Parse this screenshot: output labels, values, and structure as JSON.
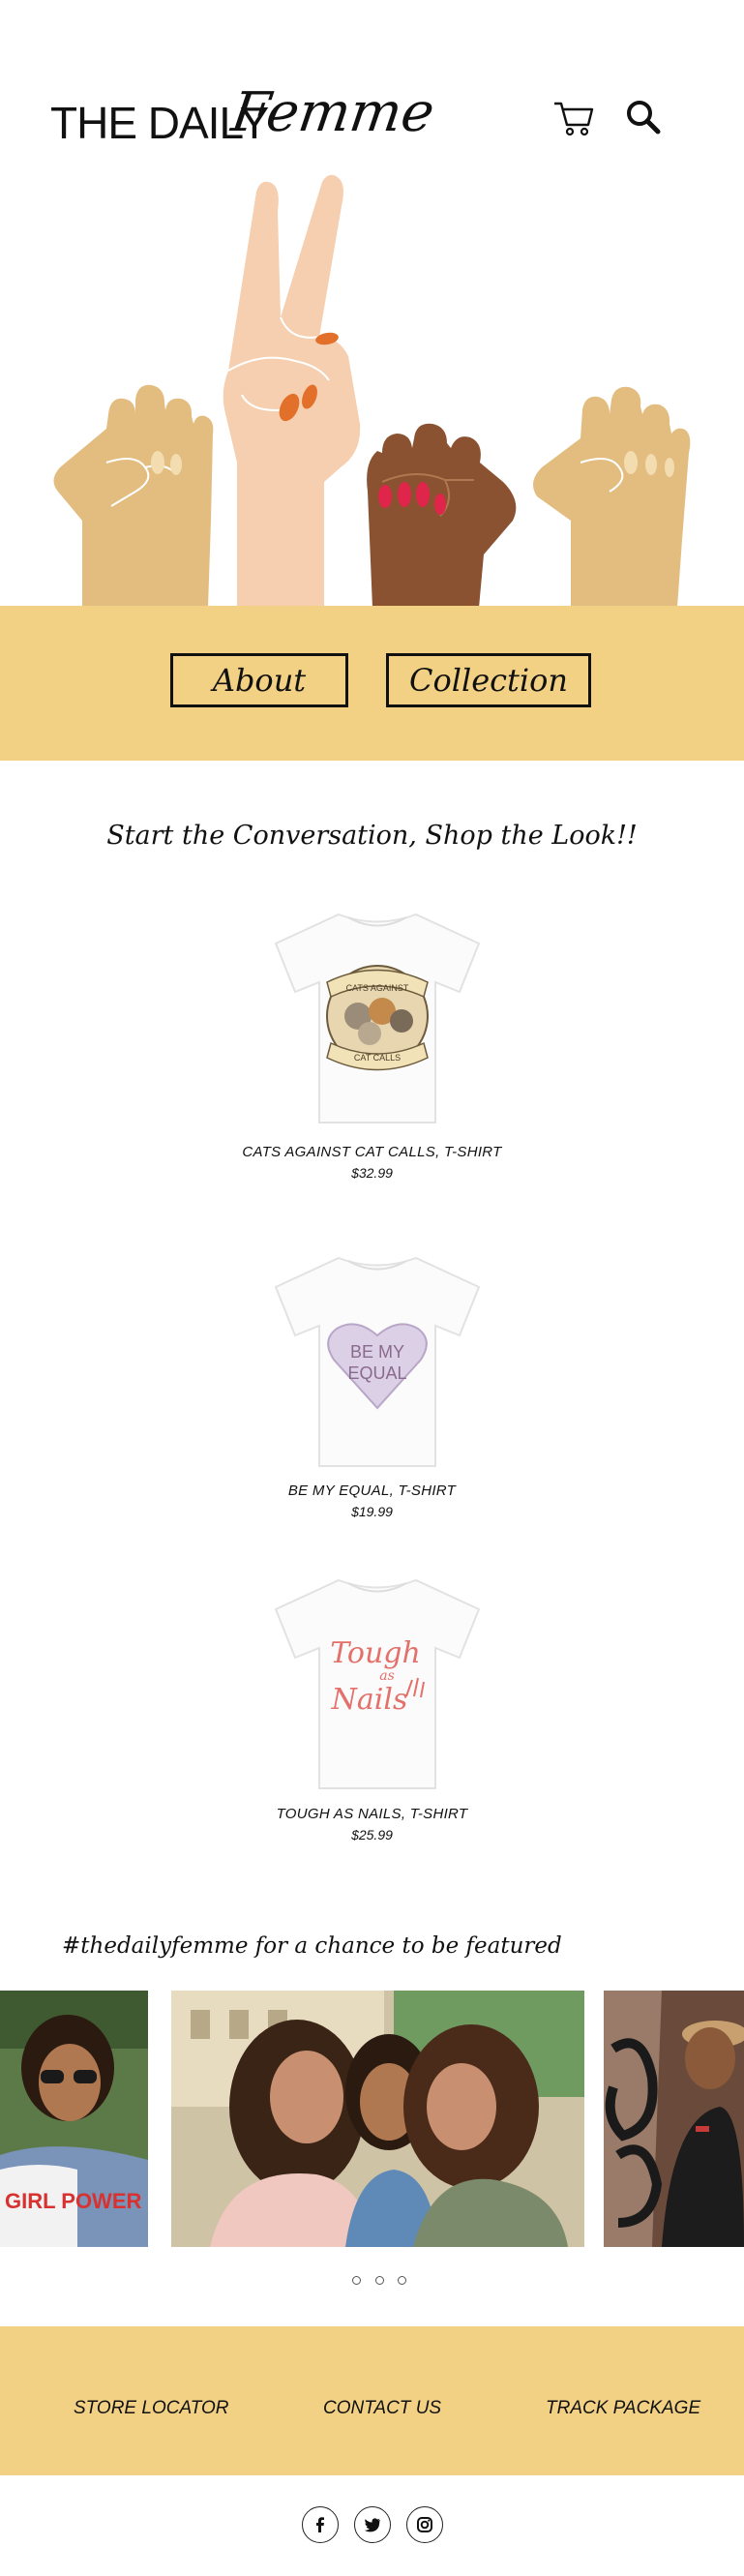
{
  "header": {
    "logo_plain": "THE DAILY",
    "logo_script": "Femme",
    "cart_icon": "cart-icon",
    "search_icon": "search-icon"
  },
  "hero": {
    "illustration": "raised-hands-illustration",
    "buttons": [
      {
        "label": "About"
      },
      {
        "label": "Collection"
      }
    ]
  },
  "main": {
    "tagline": "Start the Conversation, Shop the Look!!",
    "products": [
      {
        "name": "CATS AGAINST CAT CALLS, T-SHIRT",
        "price": "$32.99",
        "print_top": "CATS AGAINST",
        "print_bottom": "CAT CALLS"
      },
      {
        "name": "BE MY EQUAL, T-SHIRT",
        "price": "$19.99",
        "print_top": "BE MY",
        "print_bottom": "EQUAL"
      },
      {
        "name": "TOUGH AS NAILS, T-SHIRT",
        "price": "$25.99",
        "print_top": "Tough",
        "print_mid": "as",
        "print_bottom": "Nails"
      }
    ]
  },
  "feature": {
    "hashtag_text": "#thedailyfemme for a chance to be featured",
    "carousel_dots": 3,
    "left_photo_shirt_text": "GIRL POWER"
  },
  "footer": {
    "links": [
      "STORE LOCATOR",
      "CONTACT US",
      "TRACK PACKAGE"
    ],
    "social": [
      "facebook-icon",
      "twitter-icon",
      "instagram-icon"
    ]
  },
  "colors": {
    "band": "#f2d184",
    "skin_light": "#f5cfb0",
    "skin_tan": "#e3bd80",
    "skin_dark": "#8a5230",
    "nail_orange": "#e2702a",
    "nail_red": "#e0254a"
  }
}
